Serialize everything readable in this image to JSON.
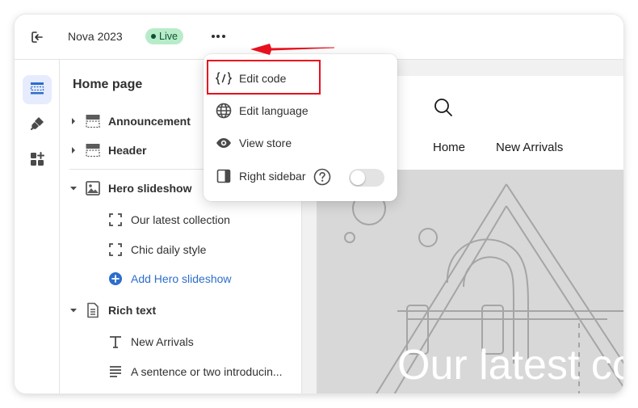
{
  "header": {
    "theme_name": "Nova 2023",
    "status_badge": "Live"
  },
  "sidebar": {
    "title": "Home page",
    "sections": [
      {
        "label": "Announcement",
        "icon": "section-layout-top-icon"
      },
      {
        "label": "Header",
        "icon": "section-layout-top-icon"
      },
      {
        "label": "Hero slideshow",
        "icon": "image-icon",
        "expanded": true,
        "children": [
          {
            "label": "Our latest collection",
            "icon": "slide-frame-icon"
          },
          {
            "label": "Chic daily style",
            "icon": "slide-frame-icon"
          },
          {
            "label": "Add Hero slideshow",
            "icon": "add-circle-icon"
          }
        ]
      },
      {
        "label": "Rich text",
        "icon": "document-icon",
        "expanded": true,
        "children": [
          {
            "label": "New Arrivals",
            "icon": "text-T-icon"
          },
          {
            "label": "A sentence or two introducin...",
            "icon": "paragraph-lines-icon"
          }
        ]
      }
    ]
  },
  "menu": {
    "items": [
      {
        "label": "Edit code",
        "icon": "code-braces-icon"
      },
      {
        "label": "Edit language",
        "icon": "globe-icon"
      },
      {
        "label": "View store",
        "icon": "eye-icon"
      },
      {
        "label": "Right sidebar",
        "icon": "sidebar-right-icon",
        "toggle_on": false
      }
    ]
  },
  "preview": {
    "nav": [
      "Home",
      "New Arrivals"
    ],
    "hero_text": "Our latest co"
  },
  "colors": {
    "accent": "#2c6ecb",
    "highlight_box": "#e8101e",
    "arrow": "#e8101e",
    "live_badge_bg": "#b8ecc9",
    "live_badge_text": "#0c5132",
    "active_rail_bg": "#e6ebfd"
  }
}
